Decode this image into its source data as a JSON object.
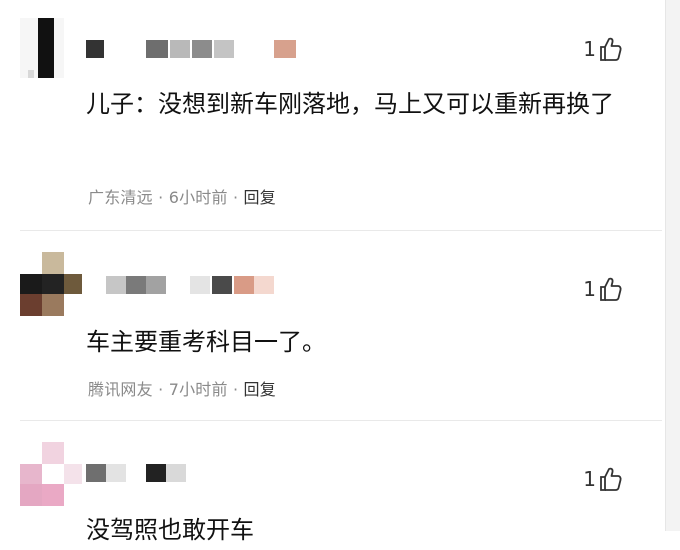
{
  "comments": [
    {
      "likes": "1",
      "content": "儿子：没想到新车刚落地，马上又可以重新再换了",
      "location": "广东清远",
      "time": "6小时前",
      "reply_label": "回复"
    },
    {
      "likes": "1",
      "content": "车主要重考科目一了。",
      "location": "腾讯网友",
      "time": "7小时前",
      "reply_label": "回复"
    },
    {
      "likes": "1",
      "content": "没驾照也敢开车"
    }
  ],
  "colors": {
    "text": "#111111",
    "meta": "#8a8a8a",
    "divider": "#e9e9e9"
  },
  "icons": [
    "thumbs-up-icon"
  ]
}
